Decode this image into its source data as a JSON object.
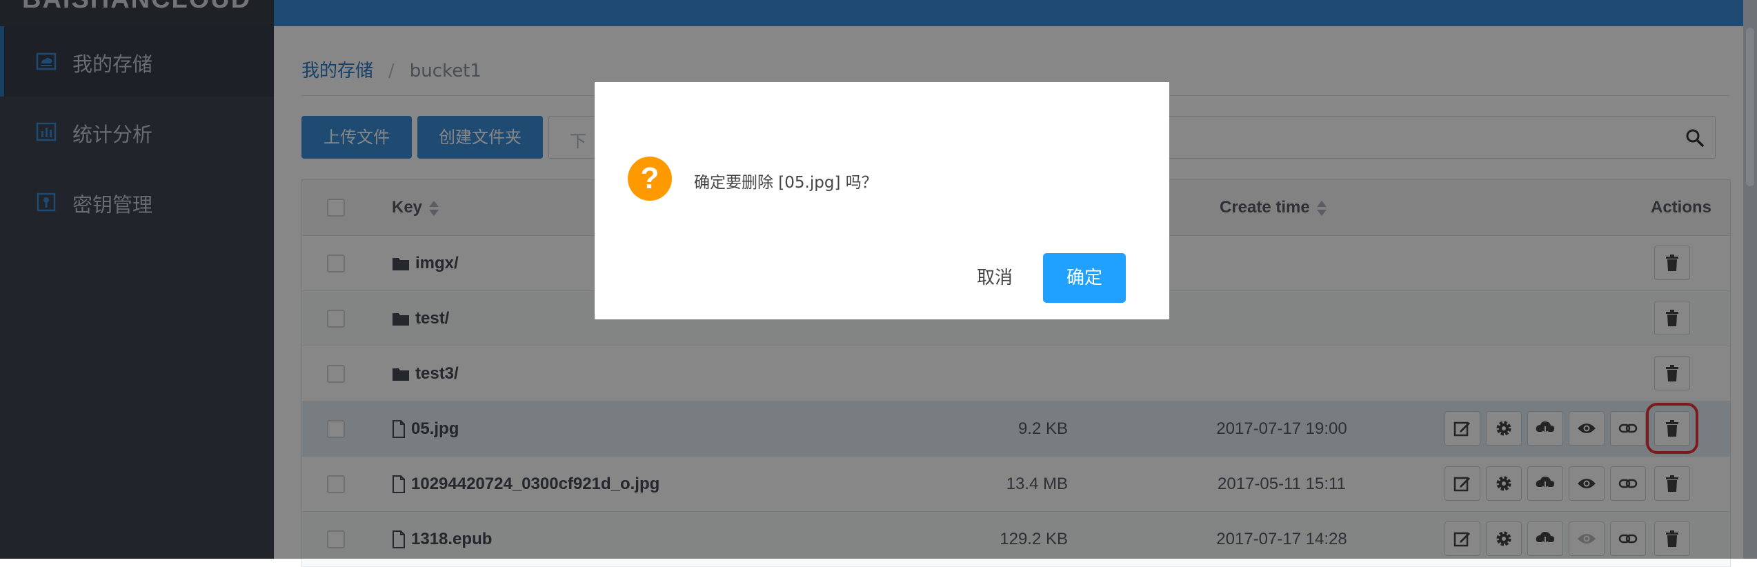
{
  "app": {
    "logo_text": "BAISHANCLOUD"
  },
  "sidebar": {
    "items": [
      {
        "label": "我的存储",
        "icon": "storage-icon",
        "active": true
      },
      {
        "label": "统计分析",
        "icon": "chart-icon",
        "active": false
      },
      {
        "label": "密钥管理",
        "icon": "key-icon",
        "active": false
      }
    ]
  },
  "breadcrumb": {
    "root": "我的存储",
    "separator": "/",
    "current": "bucket1"
  },
  "toolbar": {
    "upload_label": "上传文件",
    "create_folder_label": "创建文件夹",
    "search_placeholder": "下"
  },
  "table": {
    "columns": {
      "key": "Key",
      "create_time": "Create time",
      "actions": "Actions"
    },
    "rows": [
      {
        "type": "folder",
        "key": "imgx/",
        "size": "",
        "create_time": ""
      },
      {
        "type": "folder",
        "key": "test/",
        "size": "",
        "create_time": ""
      },
      {
        "type": "folder",
        "key": "test3/",
        "size": "",
        "create_time": ""
      },
      {
        "type": "file",
        "key": "05.jpg",
        "size": "9.2 KB",
        "create_time": "2017-07-17 19:00"
      },
      {
        "type": "file",
        "key": "10294420724_0300cf921d_o.jpg",
        "size": "13.4 MB",
        "create_time": "2017-05-11 15:11"
      },
      {
        "type": "file",
        "key": "1318.epub",
        "size": "129.2 KB",
        "create_time": "2017-07-17 14:28"
      }
    ]
  },
  "dialog": {
    "icon": "?",
    "message": "确定要删除 [05.jpg] 吗？",
    "cancel_label": "取消",
    "confirm_label": "确定"
  },
  "colors": {
    "primary": "#3b8ed8",
    "confirm": "#20a0ff",
    "warning": "#ff9900",
    "highlight": "#e8333a",
    "sidebar": "#3f4651"
  }
}
